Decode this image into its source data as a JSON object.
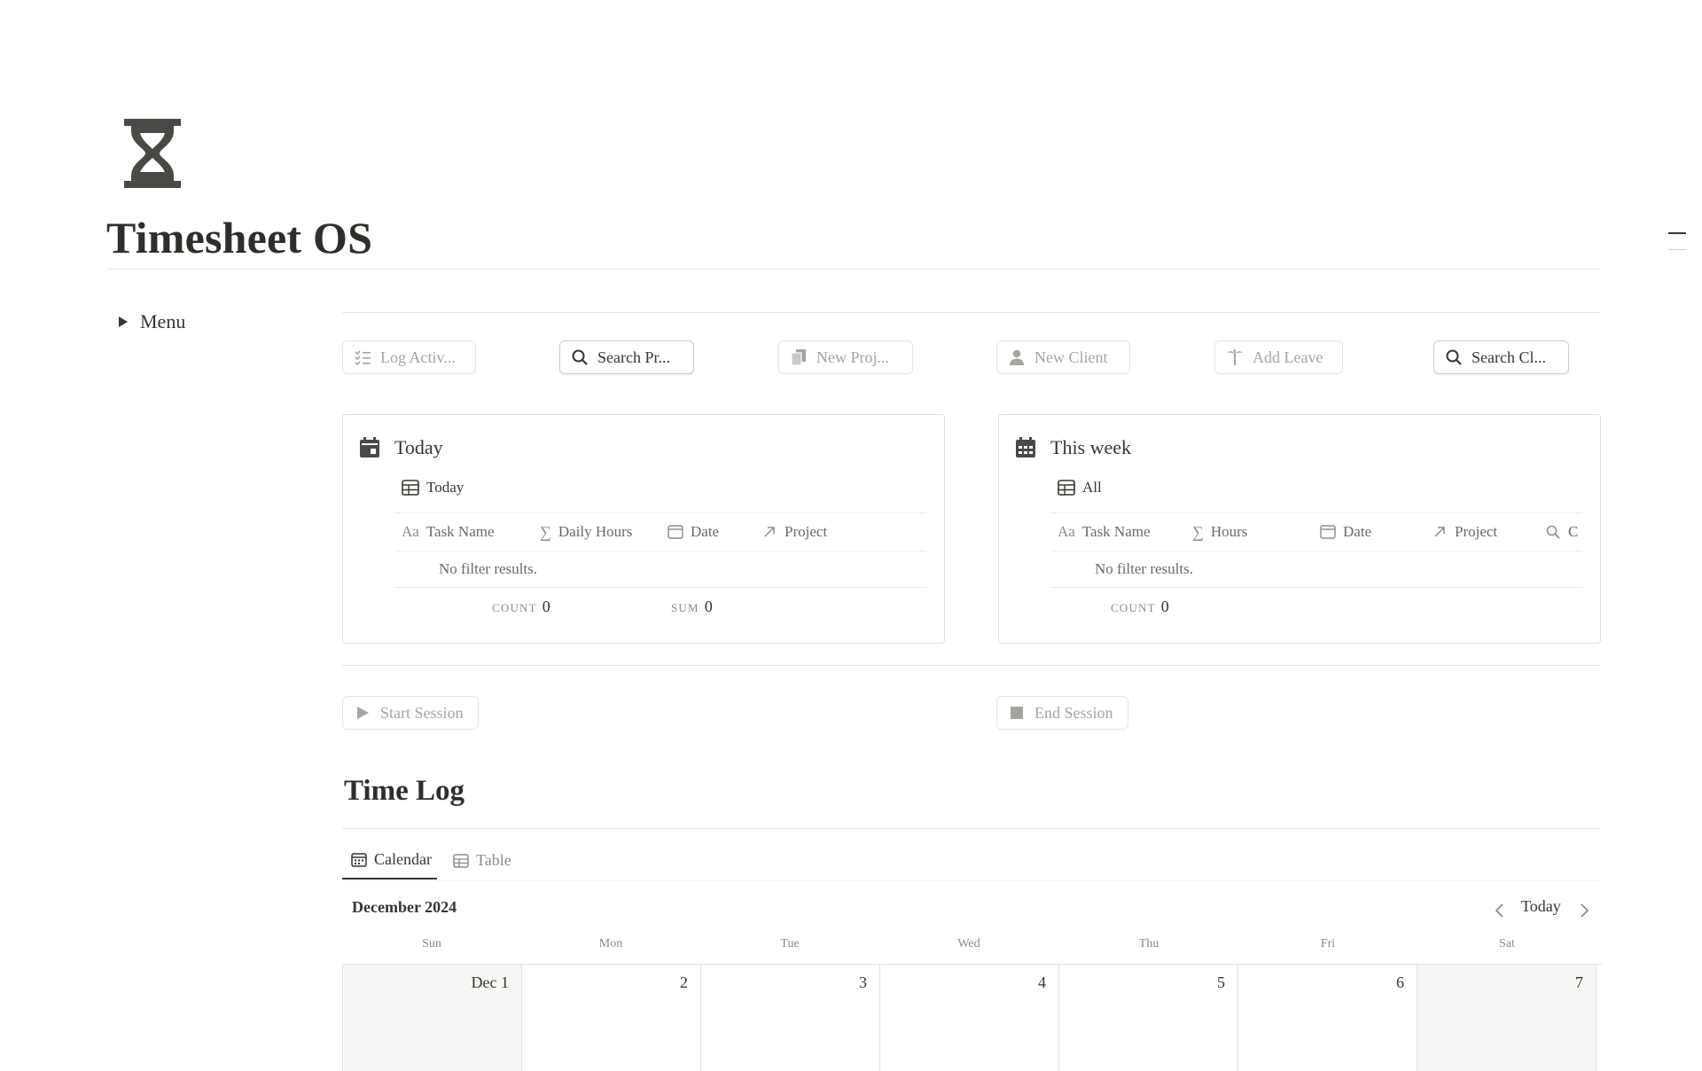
{
  "page": {
    "title": "Timesheet OS",
    "icon": "hourglass-icon"
  },
  "menu": {
    "label": "Menu"
  },
  "actions": [
    {
      "label": "Log Activ...",
      "icon": "checklist-icon"
    },
    {
      "label": "Search Pr...",
      "icon": "search-icon"
    },
    {
      "label": "New Proj...",
      "icon": "documents-icon"
    },
    {
      "label": "New Client",
      "icon": "person-icon"
    },
    {
      "label": "Add Leave",
      "icon": "palm-tree-icon"
    },
    {
      "label": "Search Cl...",
      "icon": "search-icon"
    }
  ],
  "today_card": {
    "title": "Today",
    "view": "Today",
    "columns": [
      "Task Name",
      "Daily Hours",
      "Date",
      "Project"
    ],
    "empty": "No filter results.",
    "count_label": "COUNT",
    "count_value": "0",
    "sum_label": "SUM",
    "sum_value": "0"
  },
  "week_card": {
    "title": "This week",
    "view": "All",
    "columns": [
      "Task Name",
      "Hours",
      "Date",
      "Project",
      "C"
    ],
    "empty": "No filter results.",
    "count_label": "COUNT",
    "count_value": "0"
  },
  "session": {
    "start": "Start Session",
    "end": "End Session"
  },
  "time_log": {
    "heading": "Time Log",
    "tabs": [
      "Calendar",
      "Table"
    ],
    "month": "December 2024",
    "today_button": "Today",
    "weekdays": [
      "Sun",
      "Mon",
      "Tue",
      "Wed",
      "Thu",
      "Fri",
      "Sat"
    ],
    "days": [
      "Dec 1",
      "2",
      "3",
      "4",
      "5",
      "6",
      "7"
    ]
  },
  "colors": {
    "text": "#37352f",
    "muted": "#a6a49f",
    "border": "#e6e5e1",
    "weekend": "#f7f7f5"
  }
}
